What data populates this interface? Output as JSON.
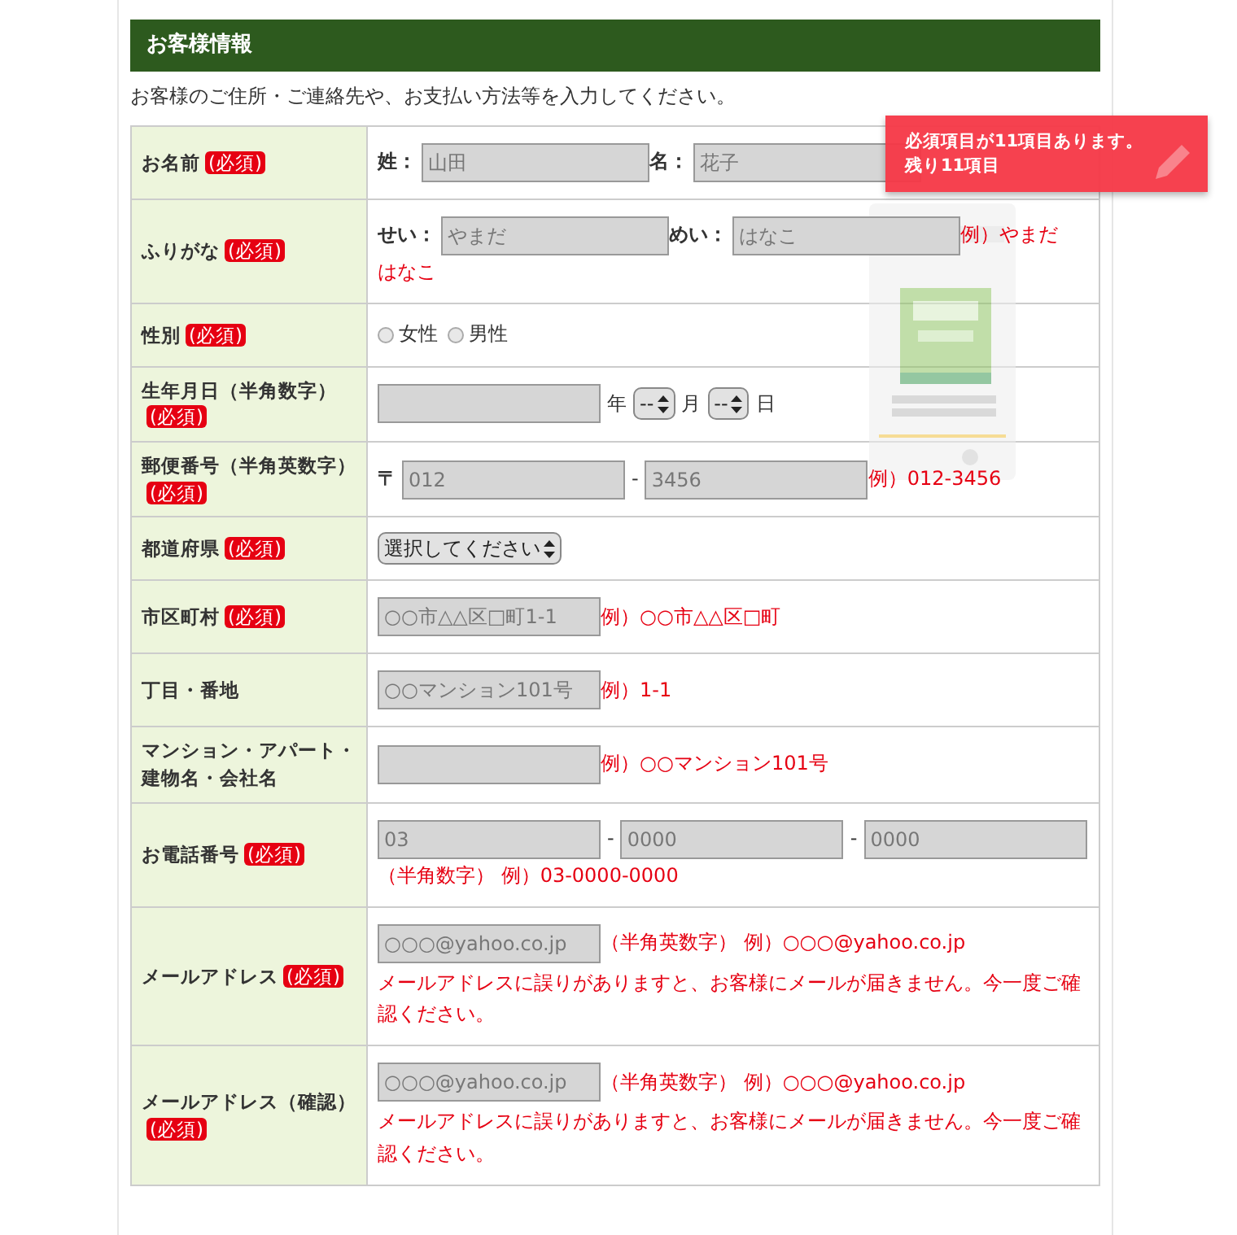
{
  "section_title": "お客様情報",
  "intro": "お客様のご住所・ご連絡先や、お支払い方法等を入力してください。",
  "banner": {
    "lines": [
      "必須項目が11項目あります。",
      "残り11項目"
    ]
  },
  "rows": [
    {
      "kind": "name",
      "label": "お名前",
      "badge": "(必須)",
      "items": [
        {
          "kind": "prefix",
          "text": "姓："
        },
        {
          "kind": "input",
          "placeholder": "山田"
        },
        {
          "kind": "prefix",
          "text": "名："
        },
        {
          "kind": "input",
          "placeholder": "花子"
        }
      ]
    },
    {
      "kind": "name",
      "label": "ふりがな",
      "badge": "(必須)",
      "items": [
        {
          "kind": "prefix",
          "text": "せい："
        },
        {
          "kind": "input",
          "placeholder": "やまだ"
        },
        {
          "kind": "prefix",
          "text": "めい："
        },
        {
          "kind": "input",
          "placeholder": "はなこ"
        },
        {
          "kind": "hint",
          "text": "例）やまだ"
        },
        {
          "kind": "hint",
          "text": "はなこ"
        }
      ]
    },
    {
      "kind": "plain",
      "label": "性別",
      "badge": "(必須)",
      "items": [
        {
          "kind": "radio",
          "text": "女性",
          "selected": false
        },
        {
          "kind": "radio",
          "text": "男性",
          "selected": false
        }
      ]
    },
    {
      "kind": "plain",
      "label": "生年月日（半角数字）",
      "badge": "(必須)",
      "items": [
        {
          "kind": "input"
        },
        {
          "kind": "unit",
          "text": "年"
        },
        {
          "kind": "select",
          "text": "--"
        },
        {
          "kind": "unit",
          "text": "月"
        },
        {
          "kind": "select",
          "text": "--"
        },
        {
          "kind": "unit",
          "text": "日"
        }
      ]
    },
    {
      "kind": "plain",
      "label": "郵便番号（半角英数字）",
      "badge": "(必須)",
      "items": [
        {
          "kind": "prefix",
          "text": "〒"
        },
        {
          "kind": "input",
          "placeholder": "012"
        },
        {
          "kind": "unit",
          "text": "-"
        },
        {
          "kind": "input",
          "placeholder": "3456"
        },
        {
          "kind": "hint",
          "text": "例）012-3456"
        }
      ]
    },
    {
      "kind": "plain",
      "label": "都道府県",
      "badge": "(必須)",
      "items": [
        {
          "kind": "select",
          "text": "選択してください"
        }
      ]
    },
    {
      "kind": "plain",
      "label": "市区町村",
      "badge": "(必須)",
      "items": [
        {
          "kind": "input",
          "placeholder": "○○市△△区□町1-1"
        },
        {
          "kind": "hint",
          "text": "例）○○市△△区□町"
        }
      ]
    },
    {
      "kind": "plain",
      "label": "丁目・番地",
      "items": [
        {
          "kind": "input",
          "placeholder": "○○マンション101号"
        },
        {
          "kind": "hint",
          "text": "例）1-1"
        }
      ]
    },
    {
      "kind": "plain",
      "label": "マンション・アパート・建物名・会社名",
      "items": [
        {
          "kind": "input"
        },
        {
          "kind": "hint",
          "text": "例）○○マンション101号"
        }
      ]
    },
    {
      "kind": "plain",
      "label": "お電話番号",
      "badge": "(必須)",
      "items": [
        {
          "kind": "input",
          "placeholder": "03"
        },
        {
          "kind": "unit",
          "text": "-"
        },
        {
          "kind": "input",
          "placeholder": "0000"
        },
        {
          "kind": "unit",
          "text": "-"
        },
        {
          "kind": "input",
          "placeholder": "0000"
        },
        {
          "kind": "hint",
          "text": "（半角数字） 例）03-0000-0000"
        }
      ]
    },
    {
      "kind": "plain",
      "label": "メールアドレス",
      "badge": "(必須)",
      "items": [
        {
          "kind": "input",
          "placeholder": "○○○@yahoo.co.jp"
        },
        {
          "kind": "hint",
          "text": "（半角英数字） 例）○○○@yahoo.co.jp"
        },
        {
          "kind": "note",
          "text": "メールアドレスに誤りがありますと、お客様にメールが届きません。今一度ご確認ください。"
        }
      ]
    },
    {
      "kind": "plain",
      "label": "メールアドレス（確認）",
      "badge": "(必須)",
      "items": [
        {
          "kind": "input",
          "placeholder": "○○○@yahoo.co.jp"
        },
        {
          "kind": "hint",
          "text": "（半角英数字） 例）○○○@yahoo.co.jp"
        },
        {
          "kind": "note",
          "text": "メールアドレスに誤りがありますと、お客様にメールが届きません。今一度ご確認ください。"
        }
      ]
    }
  ]
}
